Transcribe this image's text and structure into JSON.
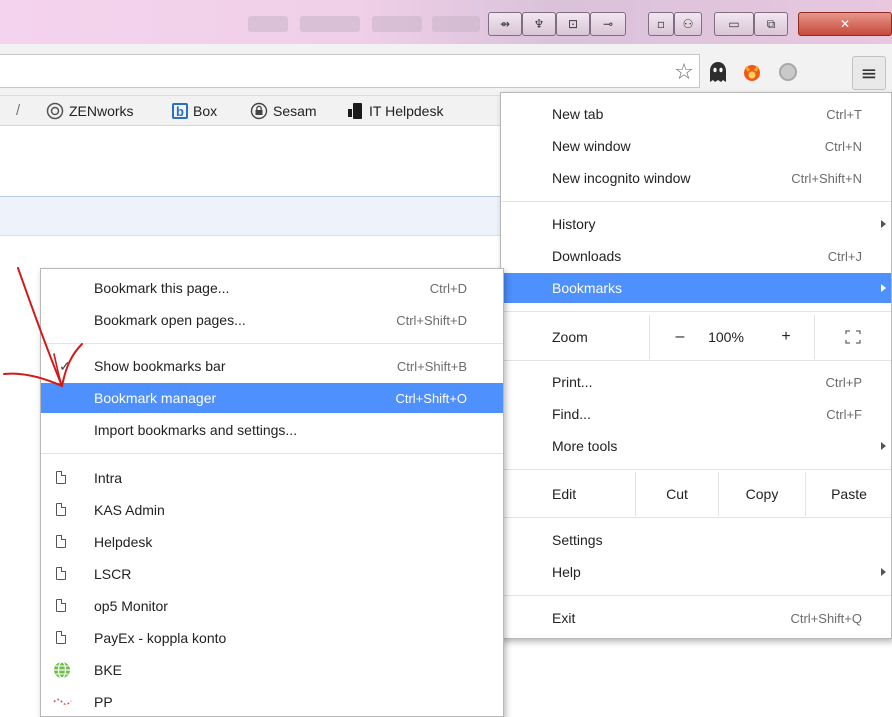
{
  "window_controls": {
    "btn1": "⇴",
    "btn2": "♆",
    "btn3": "⊡",
    "btn4": "⊸",
    "btn5": "▫",
    "btn6": "⚇",
    "minimize": "▭",
    "maximize": "⧉",
    "close": "✕"
  },
  "toolbar": {
    "icons": [
      "star-icon",
      "ghostery-icon",
      "extension-fox-icon",
      "extension-circle-icon",
      "chrome-menu-icon"
    ],
    "menu_glyph": "≡",
    "star_glyph": "☆"
  },
  "bookmarks_bar": {
    "items": [
      {
        "label": "ZENworks",
        "icon": "zenworks-icon"
      },
      {
        "label": "Box",
        "icon": "box-icon"
      },
      {
        "label": "Sesam",
        "icon": "lock-icon"
      },
      {
        "label": "IT Helpdesk",
        "icon": "helpdesk-icon"
      }
    ]
  },
  "chrome_menu": {
    "new_tab": {
      "label": "New tab",
      "shortcut": "Ctrl+T"
    },
    "new_window": {
      "label": "New window",
      "shortcut": "Ctrl+N"
    },
    "new_incognito": {
      "label": "New incognito window",
      "shortcut": "Ctrl+Shift+N"
    },
    "history": {
      "label": "History"
    },
    "downloads": {
      "label": "Downloads",
      "shortcut": "Ctrl+J"
    },
    "bookmarks": {
      "label": "Bookmarks"
    },
    "zoom": {
      "label": "Zoom",
      "minus": "–",
      "value": "100%",
      "plus": "+"
    },
    "print": {
      "label": "Print...",
      "shortcut": "Ctrl+P"
    },
    "find": {
      "label": "Find...",
      "shortcut": "Ctrl+F"
    },
    "more_tools": {
      "label": "More tools"
    },
    "edit": {
      "label": "Edit",
      "cut": "Cut",
      "copy": "Copy",
      "paste": "Paste"
    },
    "settings": {
      "label": "Settings"
    },
    "help": {
      "label": "Help"
    },
    "exit": {
      "label": "Exit",
      "shortcut": "Ctrl+Shift+Q"
    }
  },
  "bookmarks_submenu": {
    "bookmark_page": {
      "label": "Bookmark this page...",
      "shortcut": "Ctrl+D"
    },
    "bookmark_open": {
      "label": "Bookmark open pages...",
      "shortcut": "Ctrl+Shift+D"
    },
    "show_bar": {
      "label": "Show bookmarks bar",
      "shortcut": "Ctrl+Shift+B"
    },
    "manager": {
      "label": "Bookmark manager",
      "shortcut": "Ctrl+Shift+O"
    },
    "import": {
      "label": "Import bookmarks and settings..."
    },
    "bookmarks": [
      {
        "label": "Intra",
        "icon": "page-icon"
      },
      {
        "label": "KAS Admin",
        "icon": "page-icon"
      },
      {
        "label": "Helpdesk",
        "icon": "page-icon"
      },
      {
        "label": "LSCR",
        "icon": "page-icon"
      },
      {
        "label": "op5 Monitor",
        "icon": "page-icon"
      },
      {
        "label": "PayEx - koppla konto",
        "icon": "page-icon"
      },
      {
        "label": "BKE",
        "icon": "globe-icon"
      },
      {
        "label": "PP",
        "icon": "pp-icon"
      }
    ]
  },
  "colors": {
    "highlight": "#4d90fe",
    "annotation": "#d21a1a",
    "title_bar": "#f0cfe8"
  }
}
